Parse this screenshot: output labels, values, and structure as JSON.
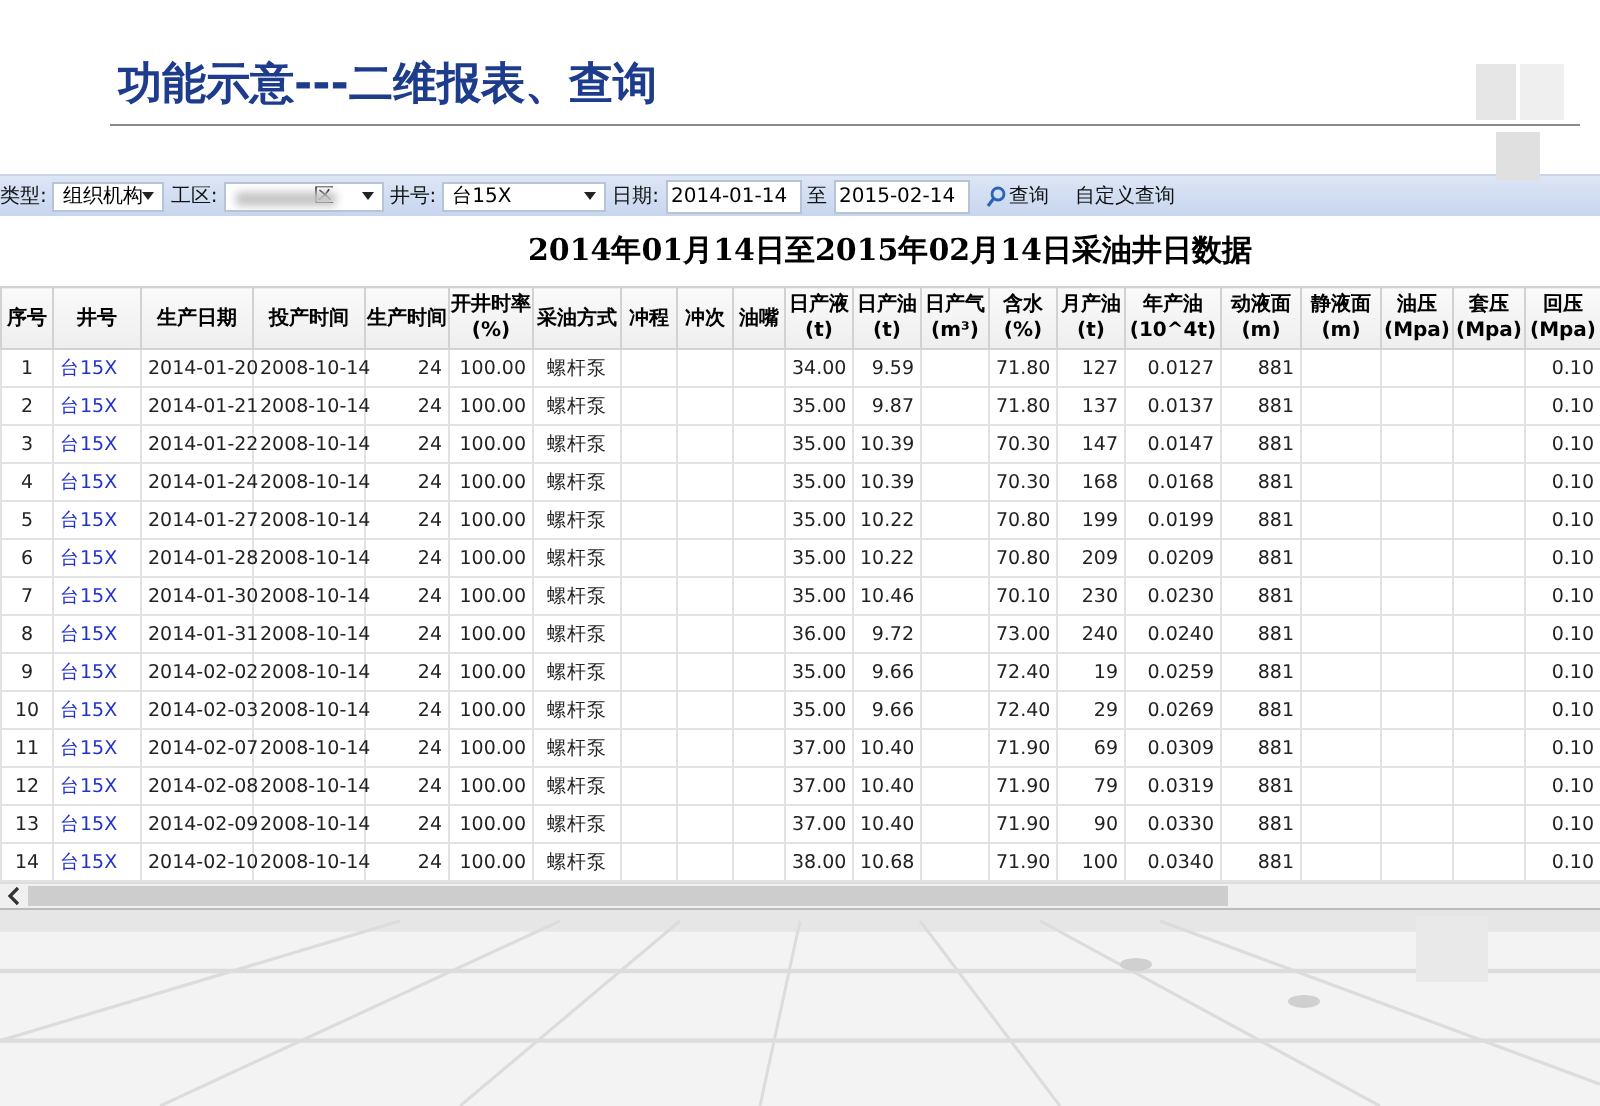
{
  "slide_title": "功能示意---二维报表、查询",
  "toolbar": [
    {
      "kind": "label",
      "text": "类型:"
    },
    {
      "kind": "select",
      "value": "组织机构"
    },
    {
      "kind": "label",
      "text": "工区:"
    },
    {
      "kind": "select",
      "value": "区",
      "redacted": true
    },
    {
      "kind": "label",
      "text": "井号:"
    },
    {
      "kind": "select",
      "value": "台15X"
    },
    {
      "kind": "label",
      "text": "日期:"
    },
    {
      "kind": "input",
      "value": "2014-01-14"
    },
    {
      "kind": "label",
      "text": "至"
    },
    {
      "kind": "input",
      "value": "2015-02-14"
    },
    {
      "kind": "search_button",
      "text": "查询"
    },
    {
      "kind": "button",
      "text": "自定义查询"
    }
  ],
  "report_title": "2014年01月14日至2015年02月14日采油井日数据",
  "table": {
    "columns": [
      {
        "label": "序号"
      },
      {
        "label": "井号"
      },
      {
        "label": "生产日期"
      },
      {
        "label": "投产时间"
      },
      {
        "label": "生产时间"
      },
      {
        "label": "开井时率",
        "unit": "(%)"
      },
      {
        "label": "采油方式"
      },
      {
        "label": "冲程"
      },
      {
        "label": "冲次"
      },
      {
        "label": "油嘴"
      },
      {
        "label": "日产液",
        "unit": "(t)"
      },
      {
        "label": "日产油",
        "unit": "(t)"
      },
      {
        "label": "日产气",
        "unit": "(m³)"
      },
      {
        "label": "含水",
        "unit": "(%)"
      },
      {
        "label": "月产油",
        "unit": "(t)"
      },
      {
        "label": "年产油",
        "unit": "(10^4t)"
      },
      {
        "label": "动液面",
        "unit": "(m)"
      },
      {
        "label": "静液面",
        "unit": "(m)"
      },
      {
        "label": "油压",
        "unit": "(Mpa)"
      },
      {
        "label": "套压",
        "unit": "(Mpa)"
      },
      {
        "label": "回压",
        "unit": "(Mpa)"
      }
    ],
    "rows": [
      [
        "1",
        "台15X",
        "2014-01-20",
        "2008-10-14",
        "24",
        "100.00",
        "螺杆泵",
        null,
        null,
        null,
        "34.00",
        "9.59",
        null,
        "71.80",
        "127",
        "0.0127",
        "881",
        null,
        null,
        null,
        "0.10"
      ],
      [
        "2",
        "台15X",
        "2014-01-21",
        "2008-10-14",
        "24",
        "100.00",
        "螺杆泵",
        null,
        null,
        null,
        "35.00",
        "9.87",
        null,
        "71.80",
        "137",
        "0.0137",
        "881",
        null,
        null,
        null,
        "0.10"
      ],
      [
        "3",
        "台15X",
        "2014-01-22",
        "2008-10-14",
        "24",
        "100.00",
        "螺杆泵",
        null,
        null,
        null,
        "35.00",
        "10.39",
        null,
        "70.30",
        "147",
        "0.0147",
        "881",
        null,
        null,
        null,
        "0.10"
      ],
      [
        "4",
        "台15X",
        "2014-01-24",
        "2008-10-14",
        "24",
        "100.00",
        "螺杆泵",
        null,
        null,
        null,
        "35.00",
        "10.39",
        null,
        "70.30",
        "168",
        "0.0168",
        "881",
        null,
        null,
        null,
        "0.10"
      ],
      [
        "5",
        "台15X",
        "2014-01-27",
        "2008-10-14",
        "24",
        "100.00",
        "螺杆泵",
        null,
        null,
        null,
        "35.00",
        "10.22",
        null,
        "70.80",
        "199",
        "0.0199",
        "881",
        null,
        null,
        null,
        "0.10"
      ],
      [
        "6",
        "台15X",
        "2014-01-28",
        "2008-10-14",
        "24",
        "100.00",
        "螺杆泵",
        null,
        null,
        null,
        "35.00",
        "10.22",
        null,
        "70.80",
        "209",
        "0.0209",
        "881",
        null,
        null,
        null,
        "0.10"
      ],
      [
        "7",
        "台15X",
        "2014-01-30",
        "2008-10-14",
        "24",
        "100.00",
        "螺杆泵",
        null,
        null,
        null,
        "35.00",
        "10.46",
        null,
        "70.10",
        "230",
        "0.0230",
        "881",
        null,
        null,
        null,
        "0.10"
      ],
      [
        "8",
        "台15X",
        "2014-01-31",
        "2008-10-14",
        "24",
        "100.00",
        "螺杆泵",
        null,
        null,
        null,
        "36.00",
        "9.72",
        null,
        "73.00",
        "240",
        "0.0240",
        "881",
        null,
        null,
        null,
        "0.10"
      ],
      [
        "9",
        "台15X",
        "2014-02-02",
        "2008-10-14",
        "24",
        "100.00",
        "螺杆泵",
        null,
        null,
        null,
        "35.00",
        "9.66",
        null,
        "72.40",
        "19",
        "0.0259",
        "881",
        null,
        null,
        null,
        "0.10"
      ],
      [
        "10",
        "台15X",
        "2014-02-03",
        "2008-10-14",
        "24",
        "100.00",
        "螺杆泵",
        null,
        null,
        null,
        "35.00",
        "9.66",
        null,
        "72.40",
        "29",
        "0.0269",
        "881",
        null,
        null,
        null,
        "0.10"
      ],
      [
        "11",
        "台15X",
        "2014-02-07",
        "2008-10-14",
        "24",
        "100.00",
        "螺杆泵",
        null,
        null,
        null,
        "37.00",
        "10.40",
        null,
        "71.90",
        "69",
        "0.0309",
        "881",
        null,
        null,
        null,
        "0.10"
      ],
      [
        "12",
        "台15X",
        "2014-02-08",
        "2008-10-14",
        "24",
        "100.00",
        "螺杆泵",
        null,
        null,
        null,
        "37.00",
        "10.40",
        null,
        "71.90",
        "79",
        "0.0319",
        "881",
        null,
        null,
        null,
        "0.10"
      ],
      [
        "13",
        "台15X",
        "2014-02-09",
        "2008-10-14",
        "24",
        "100.00",
        "螺杆泵",
        null,
        null,
        null,
        "37.00",
        "10.40",
        null,
        "71.90",
        "90",
        "0.0330",
        "881",
        null,
        null,
        null,
        "0.10"
      ],
      [
        "14",
        "台15X",
        "2014-02-10",
        "2008-10-14",
        "24",
        "100.00",
        "螺杆泵",
        null,
        null,
        null,
        "38.00",
        "10.68",
        null,
        "71.90",
        "100",
        "0.0340",
        "881",
        null,
        null,
        null,
        "0.10"
      ]
    ]
  }
}
